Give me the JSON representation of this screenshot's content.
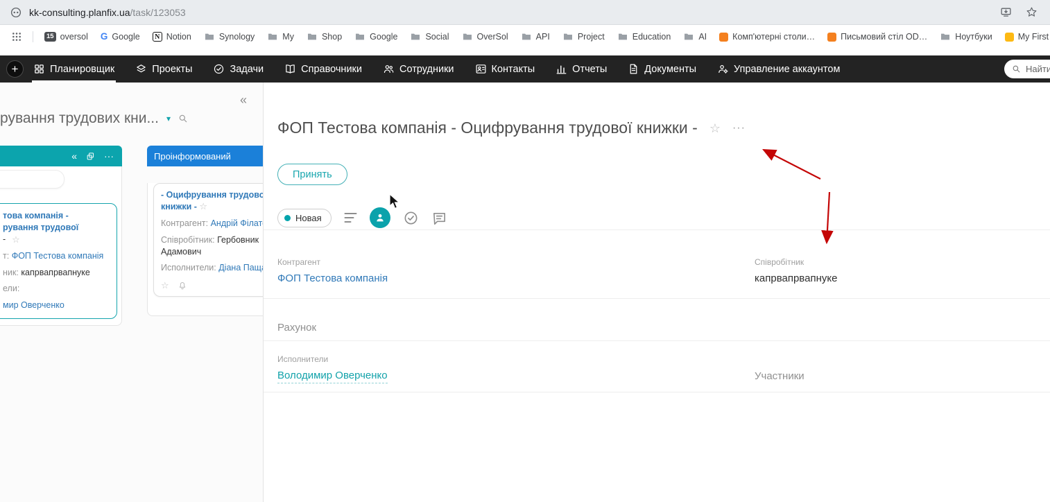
{
  "browser": {
    "url_host": "kk-consulting.planfix.ua",
    "url_path": "/task/123053",
    "bookmarks": [
      {
        "label": "oversol",
        "badge": "15"
      },
      {
        "label": "Google"
      },
      {
        "label": "Notion"
      },
      {
        "label": "Synology"
      },
      {
        "label": "My"
      },
      {
        "label": "Shop"
      },
      {
        "label": "Google"
      },
      {
        "label": "Social"
      },
      {
        "label": "OverSol"
      },
      {
        "label": "API"
      },
      {
        "label": "Project"
      },
      {
        "label": "Education"
      },
      {
        "label": "AI"
      },
      {
        "label": "Комп'ютерні столи…"
      },
      {
        "label": "Письмовий стіл OD…"
      },
      {
        "label": "Ноутбуки"
      },
      {
        "label": "My First"
      }
    ]
  },
  "nav": {
    "items": [
      {
        "label": "Планировщик",
        "active": true
      },
      {
        "label": "Проекты"
      },
      {
        "label": "Задачи"
      },
      {
        "label": "Справочники"
      },
      {
        "label": "Сотрудники"
      },
      {
        "label": "Контакты"
      },
      {
        "label": "Отчеты"
      },
      {
        "label": "Документы"
      },
      {
        "label": "Управление аккаунтом"
      }
    ],
    "search_placeholder": "Найти"
  },
  "sidebar": {
    "title": "рування трудових кни...",
    "columns": [
      {
        "header": "",
        "card": {
          "title1": "това компанія -",
          "title2": "рування трудової",
          "title3": "-",
          "f1_label": "т:",
          "f1_value": "ФОП Тестова компанія",
          "f2_label": "ник:",
          "f2_value": "капрвапрвапнуке",
          "f3_label": "ели:",
          "f4_value": "мир Оверченко"
        }
      },
      {
        "header": "Проінформований",
        "card": {
          "title": "- Оцифрування трудово книжки -",
          "f1_label": "Контрагент:",
          "f1_value": "Андрій Філато",
          "f2_label": "Співробітник:",
          "f2_value": "Гербовник Адамович",
          "f3_label": "Исполнители:",
          "f3_value": "Діана Паща"
        }
      }
    ]
  },
  "task": {
    "title": "ФОП Тестова компанія - Оцифрування трудової книжки -",
    "accept_button": "Принять",
    "status": "Новая",
    "fields": {
      "counterparty_label": "Контрагент",
      "counterparty_value": "ФОП Тестова компанія",
      "employee_label": "Співробітник",
      "employee_value": "капрвапрвапнуке",
      "account_label": "Рахунок",
      "assignees_label": "Исполнители",
      "assignees_value": "Володимир Оверченко",
      "participants_label": "Участники"
    }
  },
  "icons": {
    "collapse": "«",
    "caret_down": "▾",
    "dots_menu": "···",
    "star": "☆",
    "plus": "+",
    "google": "G",
    "notion": "N"
  },
  "colors": {
    "teal": "#0ba2ab",
    "link_blue": "#3079b8",
    "column_blue": "#1b80d9",
    "column_teal": "#0ca4ad",
    "annotation_red": "#c40606",
    "nav_background": "#232323"
  }
}
